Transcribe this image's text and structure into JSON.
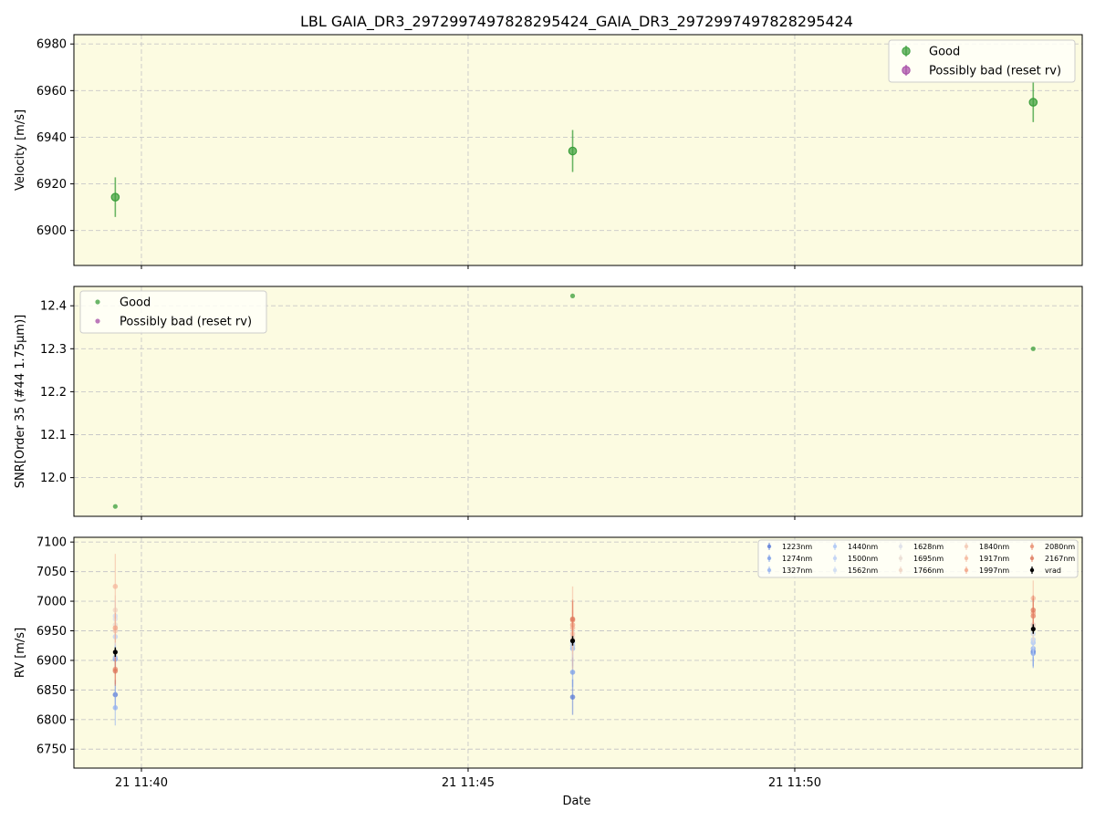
{
  "title": "LBL GAIA_DR3_2972997497828295424_GAIA_DR3_2972997497828295424",
  "xlabel": "Date",
  "x_ticks": [
    "21 11:40",
    "21 11:45",
    "21 11:50"
  ],
  "colors": {
    "panel_bg": "#fcfbe1",
    "good": "#3a9e3a",
    "bad": "#a64ca6",
    "vrad": "#000000"
  },
  "legend_top": [
    "Good",
    "Possibly bad (reset rv)"
  ],
  "legend_mid": [
    "Good",
    "Possibly bad (reset rv)"
  ],
  "chart_data": [
    {
      "type": "scatter",
      "panel": "velocity",
      "ylabel": "Velocity [m/s]",
      "ylim": [
        6885,
        6984
      ],
      "yticks": [
        6900,
        6920,
        6940,
        6960,
        6980
      ],
      "x": [
        "11:39:36",
        "11:46:36",
        "11:53:39"
      ],
      "series": [
        {
          "name": "Good",
          "values": [
            6914.3,
            6934.1,
            6955.0
          ],
          "errors": [
            8.5,
            9.0,
            8.5
          ]
        },
        {
          "name": "Possibly bad (reset rv)",
          "values": []
        }
      ],
      "legend": "top-right",
      "grid": true
    },
    {
      "type": "scatter",
      "panel": "snr",
      "ylabel": "SNR[Order 35 (#44 1.75μm)]",
      "ylim": [
        11.91,
        12.445
      ],
      "yticks": [
        12.0,
        12.1,
        12.2,
        12.3,
        12.4
      ],
      "x": [
        "11:39:36",
        "11:46:36",
        "11:53:39"
      ],
      "series": [
        {
          "name": "Good",
          "values": [
            11.933,
            12.423,
            12.3
          ]
        },
        {
          "name": "Possibly bad (reset rv)",
          "values": []
        }
      ],
      "legend": "top-left",
      "grid": true
    },
    {
      "type": "scatter",
      "panel": "rv",
      "ylabel": "RV [m/s]",
      "ylim": [
        6718,
        7108
      ],
      "yticks": [
        6750,
        6800,
        6850,
        6900,
        6950,
        7000,
        7050,
        7100
      ],
      "x": [
        "11:39:36",
        "11:46:36",
        "11:53:39"
      ],
      "series": [
        {
          "name": "1223nm",
          "color": "#5a7bd8",
          "values": [
            6842,
            6838,
            6915
          ],
          "errors": [
            25,
            30,
            25
          ]
        },
        {
          "name": "1274nm",
          "color": "#7a9de8",
          "values": [
            6902,
            6880,
            6912
          ],
          "errors": [
            25,
            25,
            25
          ]
        },
        {
          "name": "1327nm",
          "color": "#94b2f0",
          "values": [
            6820,
            6920,
            6920
          ],
          "errors": [
            30,
            30,
            30
          ]
        },
        {
          "name": "1440nm",
          "color": "#aac4f5",
          "values": [
            6905,
            6925,
            6930
          ],
          "errors": [
            25,
            25,
            25
          ]
        },
        {
          "name": "1500nm",
          "color": "#bcd0f5",
          "values": [
            6940,
            6930,
            6935
          ],
          "errors": [
            25,
            25,
            25
          ]
        },
        {
          "name": "1562nm",
          "color": "#cddbf3",
          "values": [
            6975,
            6930,
            6945
          ],
          "errors": [
            25,
            25,
            25
          ]
        },
        {
          "name": "1628nm",
          "color": "#dcdfe8",
          "values": [
            6970,
            6935,
            6960
          ],
          "errors": [
            25,
            25,
            25
          ]
        },
        {
          "name": "1695nm",
          "color": "#e8dcd3",
          "values": [
            6960,
            6940,
            6955
          ],
          "errors": [
            25,
            25,
            25
          ]
        },
        {
          "name": "1766nm",
          "color": "#efd3c3",
          "values": [
            6985,
            6935,
            6960
          ],
          "errors": [
            25,
            25,
            25
          ]
        },
        {
          "name": "1840nm",
          "color": "#f3c7b2",
          "values": [
            6950,
            6945,
            6975
          ],
          "errors": [
            25,
            25,
            25
          ]
        },
        {
          "name": "1917nm",
          "color": "#f5b79c",
          "values": [
            7025,
            6955,
            7005
          ],
          "errors": [
            55,
            70,
            30
          ]
        },
        {
          "name": "1997nm",
          "color": "#f2a386",
          "values": [
            6955,
            6960,
            6980
          ],
          "errors": [
            25,
            25,
            25
          ]
        },
        {
          "name": "2080nm",
          "color": "#e88e70",
          "values": [
            6885,
            6968,
            6975
          ],
          "errors": [
            25,
            35,
            30
          ]
        },
        {
          "name": "2167nm",
          "color": "#df7a5e",
          "values": [
            6882,
            6970,
            6985
          ],
          "errors": [
            25,
            30,
            25
          ]
        },
        {
          "name": "vrad",
          "color": "#000000",
          "values": [
            6914,
            6933,
            6953
          ],
          "errors": [
            8,
            8,
            8
          ]
        }
      ],
      "legend": "top-right",
      "grid": true
    }
  ]
}
